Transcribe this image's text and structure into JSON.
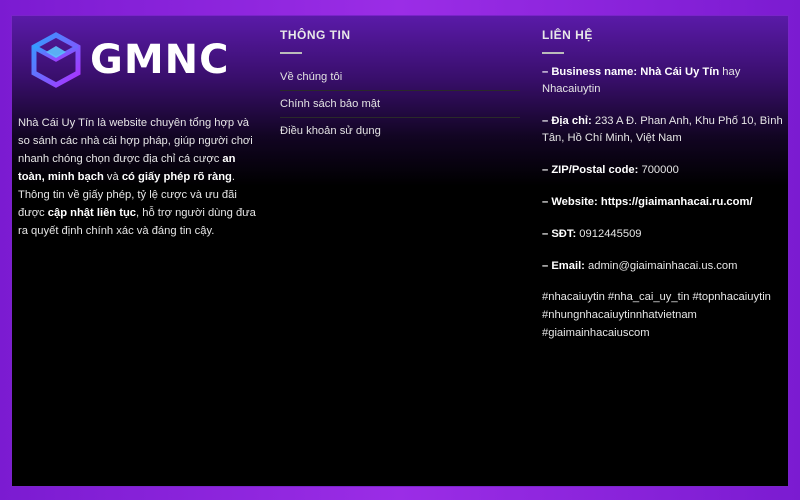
{
  "brand": {
    "name": "GMNC"
  },
  "about": {
    "part1": "Nhà Cái Uy Tín là website chuyên tổng hợp và so sánh các nhà cái hợp pháp, giúp người chơi nhanh chóng chọn được địa chỉ cá cược ",
    "bold1": "an toàn, minh bạch",
    "part2": " và ",
    "bold2": "có giấy phép rõ ràng",
    "part3": ". Thông tin về giấy phép, tỷ lệ cược và ưu đãi được ",
    "bold3": "cập nhật liên tục",
    "part4": ", hỗ trợ người dùng đưa ra quyết định chính xác và đáng tin cậy."
  },
  "info": {
    "heading": "THÔNG TIN",
    "links": [
      "Về chúng tôi",
      "Chính sách bảo mật",
      "Điều khoản sử dụng"
    ]
  },
  "contact": {
    "heading": "LIÊN HỆ",
    "business_label": "– Business name: Nhà Cái Uy Tín",
    "business_value": " hay Nhacaiuytin",
    "address_label": "– Địa chỉ:",
    "address_value": " 233 A Đ. Phan Anh, Khu Phố 10, Bình Tân, Hồ Chí Minh, Việt Nam",
    "zip_label": "– ZIP/Postal code:",
    "zip_value": " 700000",
    "website_label": "– Website: https://giaimanhacai.ru.com/",
    "phone_label": "– SĐT:",
    "phone_value": " 0912445509",
    "email_label": "– Email:",
    "email_value": " admin@giaimainhacai.us.com",
    "hashtags": [
      "#nhacaiuytin #nha_cai_uy_tin #topnhacaiuytin",
      "#nhungnhacaiuytinnhatvietnam",
      "#giaimainhacaiuscom"
    ]
  },
  "colors": {
    "background": "#6d14b8",
    "panel_top": "#5a1aa8",
    "panel_bottom": "#000000",
    "logo_gradient_start": "#2fa0ff",
    "logo_gradient_end": "#b02cff"
  }
}
